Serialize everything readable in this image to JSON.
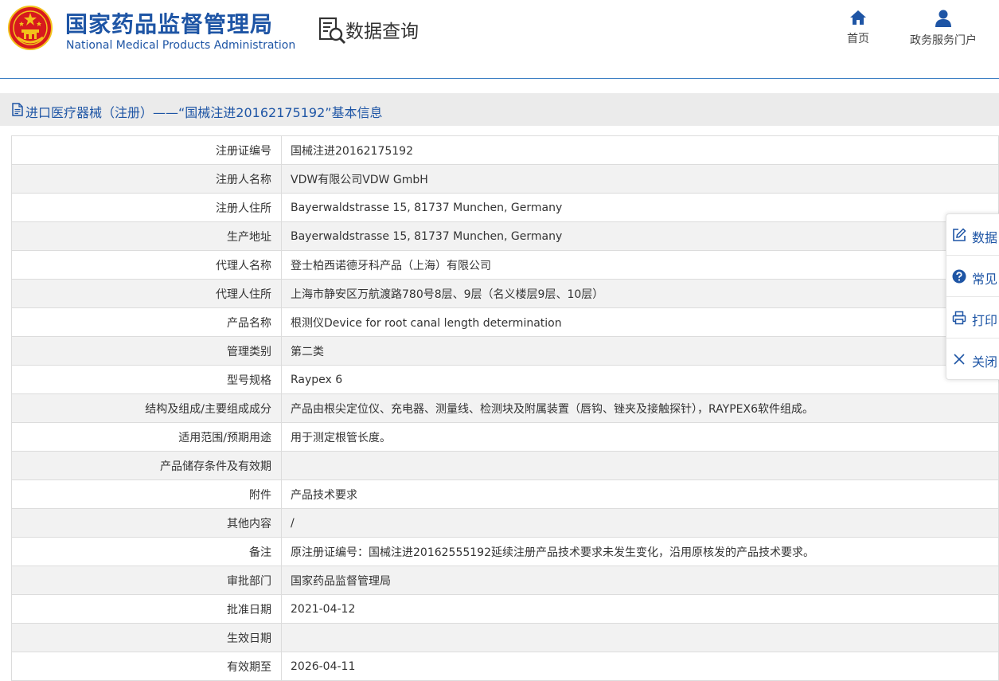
{
  "header": {
    "org_name_cn": "国家药品监督管理局",
    "org_name_en": "National Medical Products Administration",
    "query_title": "数据查询",
    "nav": [
      {
        "label": "首页",
        "icon": "home-icon"
      },
      {
        "label": "政务服务门户",
        "icon": "user-icon"
      }
    ]
  },
  "page_title": "进口医疗器械（注册）——“国械注进20162175192”基本信息",
  "rows": [
    {
      "key": "注册证编号",
      "value": "国械注进20162175192"
    },
    {
      "key": "注册人名称",
      "value": "VDW有限公司VDW GmbH"
    },
    {
      "key": "注册人住所",
      "value": "Bayerwaldstrasse 15, 81737 Munchen, Germany"
    },
    {
      "key": "生产地址",
      "value": "Bayerwaldstrasse 15, 81737 Munchen, Germany"
    },
    {
      "key": "代理人名称",
      "value": "登士柏西诺德牙科产品（上海）有限公司"
    },
    {
      "key": "代理人住所",
      "value": "上海市静安区万航渡路780号8层、9层（名义楼层9层、10层）"
    },
    {
      "key": "产品名称",
      "value": "根测仪Device for root canal length determination"
    },
    {
      "key": "管理类别",
      "value": "第二类"
    },
    {
      "key": "型号规格",
      "value": "Raypex 6"
    },
    {
      "key": "结构及组成/主要组成成分",
      "value": "产品由根尖定位仪、充电器、测量线、检测块及附属装置（唇钩、锉夹及接触探针），RAYPEX6软件组成。"
    },
    {
      "key": "适用范围/预期用途",
      "value": "用于测定根管长度。"
    },
    {
      "key": "产品储存条件及有效期",
      "value": ""
    },
    {
      "key": "附件",
      "value": "产品技术要求"
    },
    {
      "key": "其他内容",
      "value": "/"
    },
    {
      "key": "备注",
      "value": "原注册证编号：国械注进20162555192延续注册产品技术要求未发生变化，沿用原核发的产品技术要求。"
    },
    {
      "key": "审批部门",
      "value": "国家药品监督管理局"
    },
    {
      "key": "批准日期",
      "value": "2021-04-12"
    },
    {
      "key": "生效日期",
      "value": ""
    },
    {
      "key": "有效期至",
      "value": "2026-04-11"
    }
  ],
  "side_panel": [
    {
      "label": "数据",
      "icon": "edit-icon"
    },
    {
      "label": "常见",
      "icon": "help-circle-icon"
    },
    {
      "label": "打印",
      "icon": "printer-icon"
    },
    {
      "label": "关闭",
      "icon": "close-icon"
    }
  ],
  "colors": {
    "brand_blue": "#1e55a5",
    "emblem_red": "#d7191e",
    "emblem_gold": "#f2c21b"
  }
}
